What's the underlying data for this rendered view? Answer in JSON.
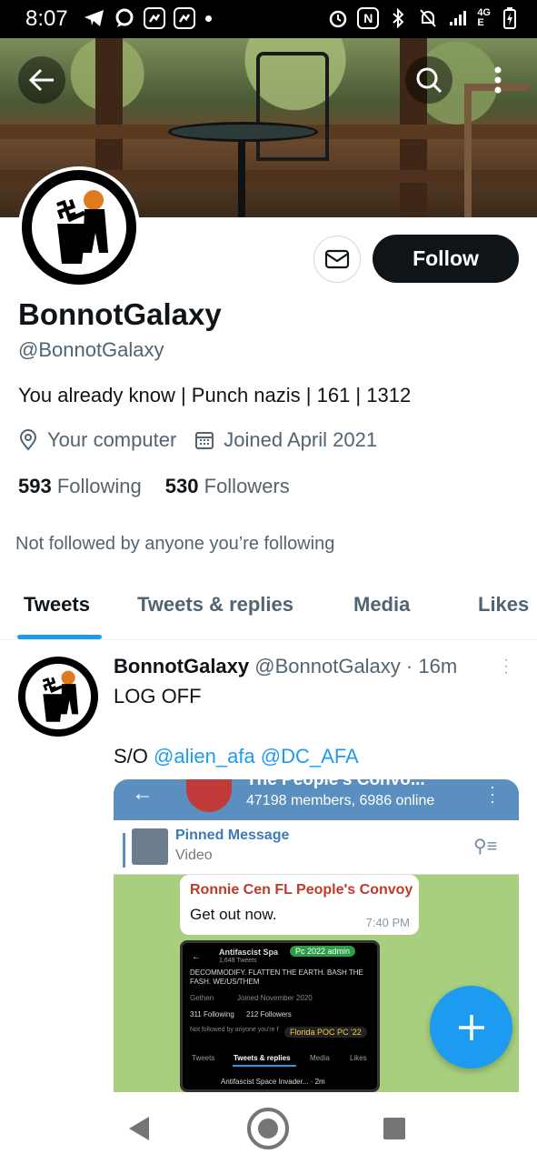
{
  "status_bar": {
    "time": "8:07",
    "network": "4G",
    "network_sub": "E"
  },
  "profile": {
    "display_name": "BonnotGalaxy",
    "handle": "@BonnotGalaxy",
    "bio": "You already know | Punch nazis | 161 | 1312",
    "location": "Your computer",
    "joined": "Joined April 2021",
    "following_count": "593",
    "following_label": "Following",
    "followers_count": "530",
    "followers_label": "Followers",
    "not_followed_text": "Not followed by anyone you’re following",
    "follow_label": "Follow"
  },
  "tabs": [
    {
      "label": "Tweets",
      "active": true
    },
    {
      "label": "Tweets & replies",
      "active": false
    },
    {
      "label": "Media",
      "active": false
    },
    {
      "label": "Likes",
      "active": false
    }
  ],
  "tweet": {
    "author_name": "BonnotGalaxy",
    "author_handle": "@BonnotGalaxy",
    "time": "· 16m",
    "text": "LOG OFF",
    "so_prefix": "S/O",
    "mention1": "@alien_afa",
    "mention2": "@DC_AFA",
    "media": {
      "group_title": "The People's Convo...",
      "group_sub": "47198 members, 6986 online",
      "pinned_title": "Pinned Message",
      "pinned_sub": "Video",
      "msg_sender": "Ronnie Cen FL People's Convoy",
      "msg_text": "Get out now.",
      "msg_time": "7:40 PM",
      "inner_name": "Antifascist Spa",
      "inner_tweets": "1,648 Tweets",
      "inner_bio1": "DECOMMODIFY. FLATTEN THE EARTH. BASH THE",
      "inner_bio2": "FASH. WE/US/THEM",
      "inner_loc": "Gethen",
      "inner_joined": "Joined November 2020",
      "inner_following": "311 Following",
      "inner_followers": "212 Followers",
      "inner_notfollowed": "Not followed by anyone you're f",
      "inner_tab1": "Tweets",
      "inner_tab2": "Tweets & replies",
      "inner_tab3": "Media",
      "inner_tab4": "Likes",
      "inner_row": "Antifascist Space Invader... · 2m",
      "tag1": "Pc 2022 admin",
      "tag2": "Florida POC PC '22"
    }
  }
}
